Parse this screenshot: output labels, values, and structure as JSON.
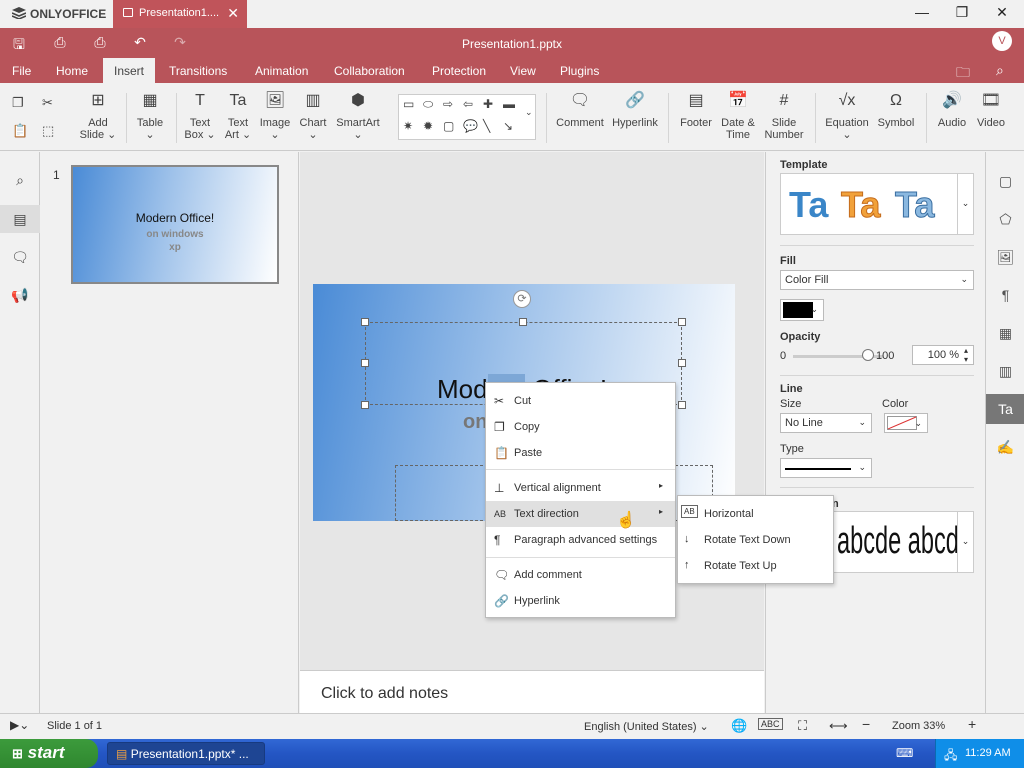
{
  "app": {
    "logo": "ONLYOFFICE",
    "doc_tab": "Presentation1....",
    "doc_title": "Presentation1.pptx",
    "user_initial": "V"
  },
  "menu": [
    "File",
    "Home",
    "Insert",
    "Transitions",
    "Animation",
    "Collaboration",
    "Protection",
    "View",
    "Plugins"
  ],
  "ribbon": {
    "add_slide": [
      "Add",
      "Slide ⌄"
    ],
    "table": [
      "Table",
      "⌄"
    ],
    "text_box": [
      "Text",
      "Box ⌄"
    ],
    "text_art": [
      "Text",
      "Art ⌄"
    ],
    "image": [
      "Image",
      "⌄"
    ],
    "chart": [
      "Chart",
      "⌄"
    ],
    "smartart": [
      "SmartArt",
      "⌄"
    ],
    "comment": "Comment",
    "hyperlink": "Hyperlink",
    "footer": "Footer",
    "date_time": [
      "Date &",
      "Time"
    ],
    "slide_number": [
      "Slide",
      "Number"
    ],
    "equation": [
      "Equation",
      "⌄"
    ],
    "symbol": "Symbol",
    "audio": "Audio",
    "video": "Video"
  },
  "thumbnail": {
    "number": "1",
    "title": "Modern Office!",
    "line2": "on windows",
    "line3": "xp"
  },
  "slide": {
    "title_a": "Mod",
    "title_hl": "ern",
    "title_b": " Office!",
    "subtitle": "on"
  },
  "notes": "Click to add notes",
  "right_panel": {
    "template_label": "Template",
    "template_sample": "Ta",
    "fill_label": "Fill",
    "fill_value": "Color Fill",
    "fill_color": "#000000",
    "opacity_label": "Opacity",
    "opacity_min": "0",
    "opacity_max": "100",
    "opacity_value": "100 %",
    "line_label": "Line",
    "size_label": "Size",
    "size_value": "No Line",
    "color_label": "Color",
    "type_label": "Type",
    "transform_label": "n",
    "wordart_sample": "abcde abcde"
  },
  "context_menu": {
    "cut": "Cut",
    "copy": "Copy",
    "paste": "Paste",
    "vertical_alignment": "Vertical alignment",
    "text_direction": "Text direction",
    "paragraph_settings": "Paragraph advanced settings",
    "add_comment": "Add comment",
    "hyperlink": "Hyperlink"
  },
  "submenu": {
    "horizontal": "Horizontal",
    "rotate_down": "Rotate Text Down",
    "rotate_up": "Rotate Text Up"
  },
  "status": {
    "slide_of": "Slide 1 of 1",
    "language": "English (United States)",
    "zoom": "Zoom 33%"
  },
  "taskbar": {
    "start": "start",
    "task": "Presentation1.pptx* ...",
    "time": "11:29 AM"
  },
  "colors": {
    "header": "#b8545a",
    "tab": "#c0545a",
    "taskbar": "#2456c4",
    "start": "#2f872f"
  }
}
